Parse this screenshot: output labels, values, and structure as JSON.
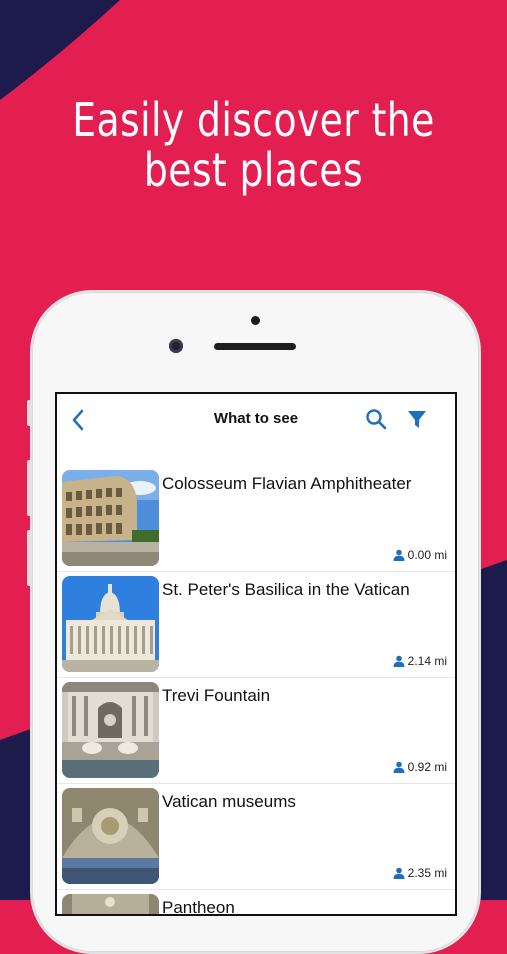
{
  "promo": {
    "headline_line1": "Easily discover the",
    "headline_line2": "best places"
  },
  "colors": {
    "background": "#E31E50",
    "navy": "#1D1B4C",
    "accent": "#1E6FBF"
  },
  "navbar": {
    "title": "What to see",
    "back_icon": "chevron-left-icon",
    "search_icon": "search-icon",
    "filter_icon": "filter-icon"
  },
  "places": [
    {
      "name": "Colosseum Flavian Amphitheater",
      "distance": "0.00 mi"
    },
    {
      "name": "St. Peter's Basilica in the Vatican",
      "distance": "2.14 mi"
    },
    {
      "name": "Trevi Fountain",
      "distance": "0.92 mi"
    },
    {
      "name": "Vatican museums",
      "distance": "2.35 mi"
    },
    {
      "name": "Pantheon",
      "distance": ""
    }
  ]
}
